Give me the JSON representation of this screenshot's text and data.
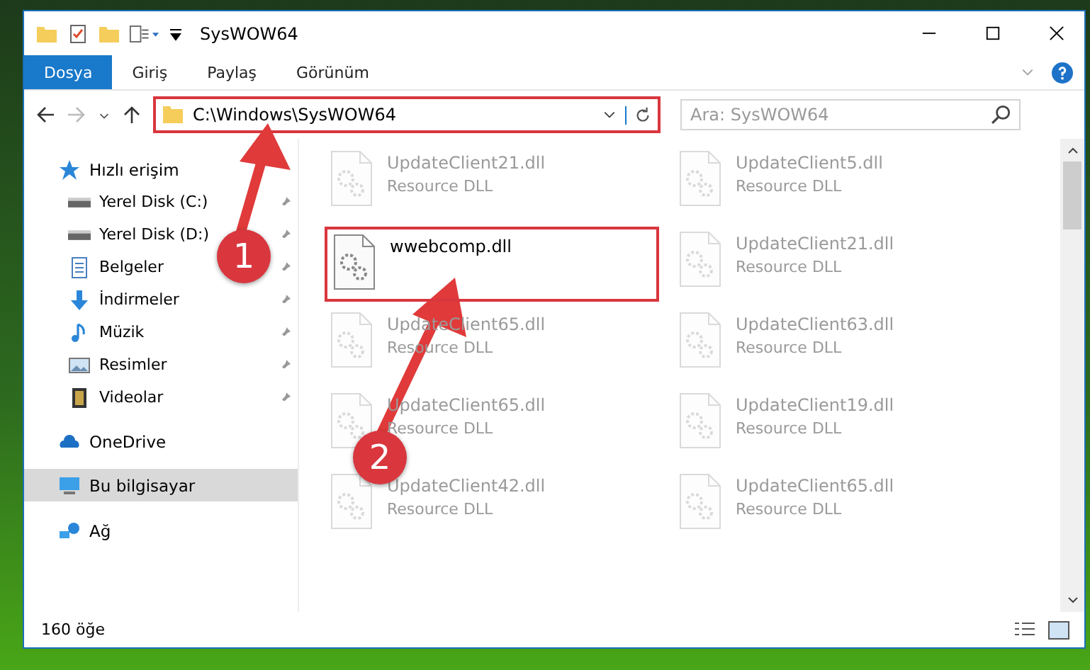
{
  "window": {
    "title": "SysWOW64"
  },
  "ribbon": {
    "tabs": [
      {
        "label": "Dosya",
        "selected": true
      },
      {
        "label": "Giriş",
        "selected": false
      },
      {
        "label": "Paylaş",
        "selected": false
      },
      {
        "label": "Görünüm",
        "selected": false
      }
    ]
  },
  "address_bar": {
    "path": "C:\\Windows\\SysWOW64",
    "highlighted": true
  },
  "search": {
    "placeholder": "Ara: SysWOW64"
  },
  "sidebar": {
    "items": [
      {
        "label": "Hızlı erişim",
        "kind": "star",
        "selected": false,
        "children": [
          {
            "label": "Yerel Disk (C:)",
            "kind": "drive",
            "pinned": true,
            "selected": false
          },
          {
            "label": "Yerel Disk (D:)",
            "kind": "drive",
            "pinned": true,
            "selected": false
          },
          {
            "label": "Belgeler",
            "kind": "documents",
            "pinned": true,
            "selected": false
          },
          {
            "label": "İndirmeler",
            "kind": "downloads",
            "pinned": true,
            "selected": false
          },
          {
            "label": "Müzik",
            "kind": "music",
            "pinned": true,
            "selected": false
          },
          {
            "label": "Resimler",
            "kind": "pictures",
            "pinned": true,
            "selected": false
          },
          {
            "label": "Videolar",
            "kind": "videos",
            "pinned": true,
            "selected": false
          }
        ]
      },
      {
        "label": "OneDrive",
        "kind": "cloud",
        "selected": false
      },
      {
        "label": "Bu bilgisayar",
        "kind": "computer",
        "selected": true
      },
      {
        "label": "Ağ",
        "kind": "network",
        "selected": false
      }
    ]
  },
  "files": [
    {
      "name": "UpdateClient21.dll",
      "type": "Resource DLL",
      "faded": true,
      "highlighted": false
    },
    {
      "name": "UpdateClient5.dll",
      "type": "Resource DLL",
      "faded": true,
      "highlighted": false
    },
    {
      "name": "wwebcomp.dll",
      "faded": false,
      "highlighted": true
    },
    {
      "name": "UpdateClient21.dll",
      "type": "Resource DLL",
      "faded": true,
      "highlighted": false
    },
    {
      "name": "UpdateClient65.dll",
      "type": "Resource DLL",
      "faded": true,
      "highlighted": false
    },
    {
      "name": "UpdateClient63.dll",
      "type": "Resource DLL",
      "faded": true,
      "highlighted": false
    },
    {
      "name": "UpdateClient65.dll",
      "type": "Resource DLL",
      "faded": true,
      "highlighted": false
    },
    {
      "name": "UpdateClient19.dll",
      "type": "Resource DLL",
      "faded": true,
      "highlighted": false
    },
    {
      "name": "UpdateClient42.dll",
      "type": "Resource DLL",
      "faded": true,
      "highlighted": false
    },
    {
      "name": "UpdateClient65.dll",
      "type": "Resource DLL",
      "faded": true,
      "highlighted": false
    }
  ],
  "status_bar": {
    "item_count": "160 öğe"
  },
  "annotations": [
    {
      "number": "1"
    },
    {
      "number": "2"
    }
  ]
}
